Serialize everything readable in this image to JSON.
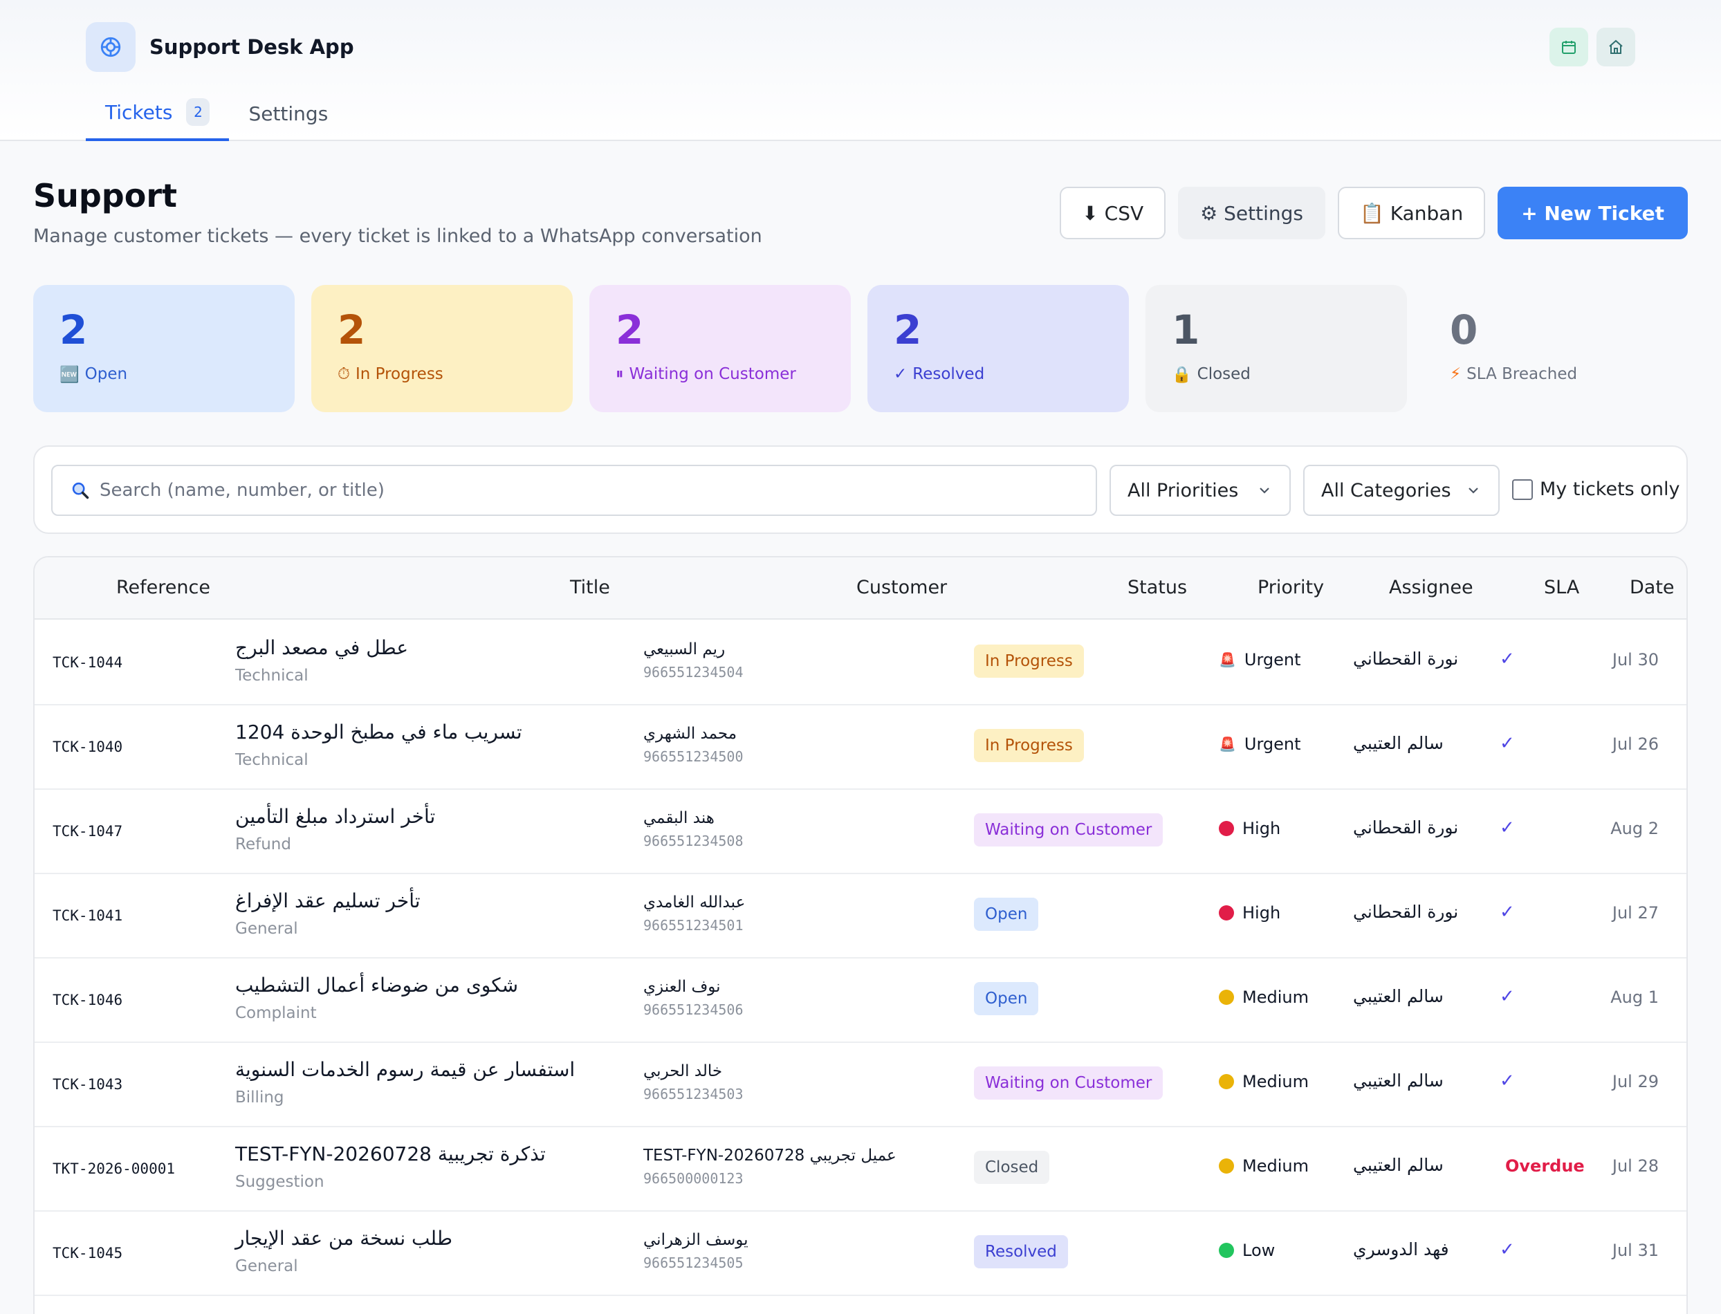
{
  "app": {
    "title": "Support Desk App"
  },
  "nav": {
    "tabs": [
      {
        "label": "Tickets",
        "badge": "2"
      },
      {
        "label": "Settings"
      }
    ]
  },
  "header": {
    "title": "Support",
    "subtitle": "Manage customer tickets — every ticket is linked to a WhatsApp conversation",
    "csv_label": "⬇ CSV",
    "settings_label": "⚙ Settings",
    "kanban_label": "📋 Kanban",
    "new_ticket_label": "+ New Ticket"
  },
  "stats": [
    {
      "value": "2",
      "icon": "🆕",
      "label": "Open"
    },
    {
      "value": "2",
      "icon": "⏱",
      "label": "In Progress"
    },
    {
      "value": "2",
      "icon": "⏸",
      "label": "Waiting on Customer"
    },
    {
      "value": "2",
      "icon": "✓",
      "label": "Resolved"
    },
    {
      "value": "1",
      "icon": "🔒",
      "label": "Closed"
    },
    {
      "value": "0",
      "icon": "⚡",
      "label": "SLA Breached"
    }
  ],
  "filters": {
    "search_placeholder": "Search (name, number, or title)",
    "priority_selected": "All Priorities",
    "category_selected": "All Categories",
    "mine_label": "My tickets only"
  },
  "table": {
    "headers": [
      "Reference",
      "Title",
      "Customer",
      "Status",
      "Priority",
      "Assignee",
      "SLA",
      "Date"
    ],
    "rows": [
      {
        "ref": "TCK-1044",
        "title": "عطل في مصعد البرج",
        "category": "Technical",
        "customer": "ريم السبيعي",
        "phone": "966551234504",
        "status": "In Progress",
        "priority": "Urgent",
        "assignee": "نورة القحطاني",
        "sla": "✓",
        "date": "Jul 30"
      },
      {
        "ref": "TCK-1040",
        "title": "تسريب ماء في مطبخ الوحدة 1204",
        "category": "Technical",
        "customer": "محمد الشهري",
        "phone": "966551234500",
        "status": "In Progress",
        "priority": "Urgent",
        "assignee": "سالم العتيبي",
        "sla": "✓",
        "date": "Jul 26"
      },
      {
        "ref": "TCK-1047",
        "title": "تأخر استرداد مبلغ التأمين",
        "category": "Refund",
        "customer": "هند البقمي",
        "phone": "966551234508",
        "status": "Waiting on Customer",
        "priority": "High",
        "assignee": "نورة القحطاني",
        "sla": "✓",
        "date": "Aug 2"
      },
      {
        "ref": "TCK-1041",
        "title": "تأخر تسليم عقد الإفراغ",
        "category": "General",
        "customer": "عبدالله الغامدي",
        "phone": "966551234501",
        "status": "Open",
        "priority": "High",
        "assignee": "نورة القحطاني",
        "sla": "✓",
        "date": "Jul 27"
      },
      {
        "ref": "TCK-1046",
        "title": "شكوى من ضوضاء أعمال التشطيب",
        "category": "Complaint",
        "customer": "نوف العنزي",
        "phone": "966551234506",
        "status": "Open",
        "priority": "Medium",
        "assignee": "سالم العتيبي",
        "sla": "✓",
        "date": "Aug 1"
      },
      {
        "ref": "TCK-1043",
        "title": "استفسار عن قيمة رسوم الخدمات السنوية",
        "category": "Billing",
        "customer": "خالد الحربي",
        "phone": "966551234503",
        "status": "Waiting on Customer",
        "priority": "Medium",
        "assignee": "سالم العتيبي",
        "sla": "✓",
        "date": "Jul 29"
      },
      {
        "ref": "TKT-2026-00001",
        "title": "TEST-FYN-20260728 تذكرة تجريبية",
        "category": "Suggestion",
        "customer": "TEST-FYN-20260728 عميل تجريبي",
        "phone": "966500000123",
        "status": "Closed",
        "priority": "Medium",
        "assignee": "سالم العتيبي",
        "sla": "Overdue",
        "date": "Jul 28"
      },
      {
        "ref": "TCK-1045",
        "title": "طلب نسخة من عقد الإيجار",
        "category": "General",
        "customer": "يوسف الزهراني",
        "phone": "966551234505",
        "status": "Resolved",
        "priority": "Low",
        "assignee": "فهد الدوسري",
        "sla": "✓",
        "date": "Jul 31"
      }
    ]
  },
  "colors": {
    "accent": "#3b82f6",
    "urgent": "#ef4444",
    "high": "#e11d48",
    "medium": "#eab308",
    "low": "#22c55e",
    "overdue": "#e11d48"
  }
}
